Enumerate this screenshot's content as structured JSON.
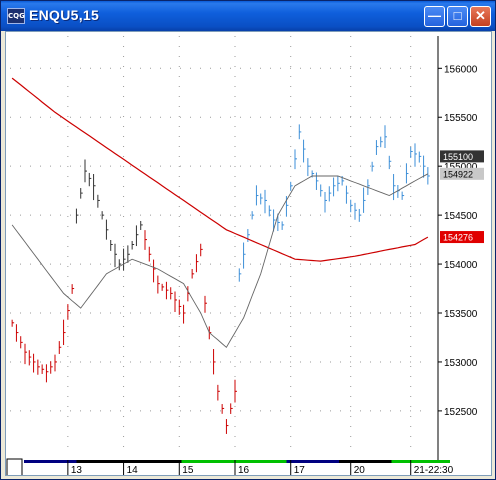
{
  "window": {
    "title": "ENQU5,15",
    "icon": "cqg-app-icon",
    "buttons": {
      "minimize": "minimize-icon",
      "maximize": "maximize-icon",
      "close": "close-icon"
    }
  },
  "colors": {
    "down": "#cc0000",
    "up": "#3d8fd8",
    "neutral": "#333333",
    "ma_long": "#cc0000",
    "ma_short": "#666666",
    "tag_dark_bg": "#333333",
    "tag_light_bg": "#c8c8c8",
    "tag_red_bg": "#e00000"
  },
  "chart_data": {
    "type": "bar",
    "symbol": "ENQU5",
    "interval_minutes": 15,
    "y_ticks": [
      152500,
      153000,
      153500,
      154000,
      154500,
      155000,
      155500,
      156000
    ],
    "y_tick_labels": [
      "152500",
      "153000",
      "153500",
      "154000",
      "154500",
      "155000",
      "155500",
      "156000"
    ],
    "ylim": [
      152080,
      156330
    ],
    "price_tags": [
      {
        "label": "155100",
        "value": 155100,
        "style": "dark"
      },
      {
        "label": "154922",
        "value": 154922,
        "style": "light"
      },
      {
        "label": "154276",
        "value": 154276,
        "style": "red"
      }
    ],
    "date_labels": [
      {
        "label": "13",
        "x": 13
      },
      {
        "label": "14",
        "x": 26
      },
      {
        "label": "15",
        "x": 39
      },
      {
        "label": "16",
        "x": 52
      },
      {
        "label": "17",
        "x": 65
      },
      {
        "label": "20",
        "x": 79
      },
      {
        "label": "21-22:30",
        "x": 93
      }
    ],
    "date_strip_colors": [
      "#000080",
      "#000000",
      "#000000",
      "#00c000",
      "#00c000",
      "#000080",
      "#000000",
      "#00c000"
    ],
    "bar_groups": [
      {
        "color": "down",
        "from": 0,
        "to": 14,
        "keys": [
          [
            0,
            153400
          ],
          [
            3,
            153100
          ],
          [
            6,
            152950
          ],
          [
            8,
            152900
          ],
          [
            10,
            153000
          ],
          [
            12,
            153300
          ],
          [
            14,
            153750
          ]
        ]
      },
      {
        "color": "neutral",
        "from": 15,
        "to": 30,
        "keys": [
          [
            15,
            154500
          ],
          [
            17,
            154950
          ],
          [
            19,
            154800
          ],
          [
            21,
            154500
          ],
          [
            23,
            154200
          ],
          [
            25,
            154000
          ],
          [
            27,
            154100
          ],
          [
            29,
            154300
          ],
          [
            30,
            154400
          ]
        ]
      },
      {
        "color": "down",
        "from": 31,
        "to": 52,
        "keys": [
          [
            31,
            154250
          ],
          [
            34,
            153800
          ],
          [
            37,
            153700
          ],
          [
            40,
            153500
          ],
          [
            42,
            153900
          ],
          [
            44,
            154150
          ],
          [
            45,
            153600
          ],
          [
            46,
            153300
          ],
          [
            48,
            152700
          ],
          [
            50,
            152350
          ],
          [
            52,
            152700
          ]
        ]
      },
      {
        "color": "up",
        "from": 53,
        "to": 97,
        "keys": [
          [
            53,
            153900
          ],
          [
            55,
            154300
          ],
          [
            57,
            154700
          ],
          [
            59,
            154650
          ],
          [
            61,
            154450
          ],
          [
            63,
            154400
          ],
          [
            65,
            154800
          ],
          [
            67,
            155350
          ],
          [
            69,
            155000
          ],
          [
            71,
            154850
          ],
          [
            73,
            154650
          ],
          [
            75,
            154800
          ],
          [
            77,
            154850
          ],
          [
            79,
            154600
          ],
          [
            81,
            154500
          ],
          [
            83,
            154800
          ],
          [
            85,
            155200
          ],
          [
            87,
            155300
          ],
          [
            89,
            154800
          ],
          [
            91,
            154700
          ],
          [
            93,
            155150
          ],
          [
            95,
            155100
          ],
          [
            97,
            154900
          ]
        ]
      }
    ],
    "series": [
      {
        "keys": [
          [
            0,
            155900
          ],
          [
            10,
            155550
          ],
          [
            20,
            155250
          ],
          [
            30,
            154950
          ],
          [
            40,
            154650
          ],
          [
            50,
            154350
          ],
          [
            58,
            154200
          ],
          [
            66,
            154050
          ],
          [
            72,
            154030
          ],
          [
            80,
            154080
          ],
          [
            88,
            154150
          ],
          [
            94,
            154200
          ],
          [
            97,
            154276
          ]
        ]
      },
      {
        "keys": [
          [
            0,
            154400
          ],
          [
            6,
            154050
          ],
          [
            12,
            153700
          ],
          [
            16,
            153550
          ],
          [
            22,
            153900
          ],
          [
            28,
            154050
          ],
          [
            34,
            153950
          ],
          [
            40,
            153800
          ],
          [
            44,
            153500
          ],
          [
            46,
            153300
          ],
          [
            50,
            153150
          ],
          [
            54,
            153450
          ],
          [
            58,
            153900
          ],
          [
            62,
            154500
          ],
          [
            66,
            154800
          ],
          [
            70,
            154900
          ],
          [
            76,
            154900
          ],
          [
            82,
            154800
          ],
          [
            88,
            154700
          ],
          [
            94,
            154850
          ],
          [
            97,
            154922
          ]
        ]
      }
    ]
  },
  "footer": {
    "selector_icon": "period-selector-icon"
  }
}
